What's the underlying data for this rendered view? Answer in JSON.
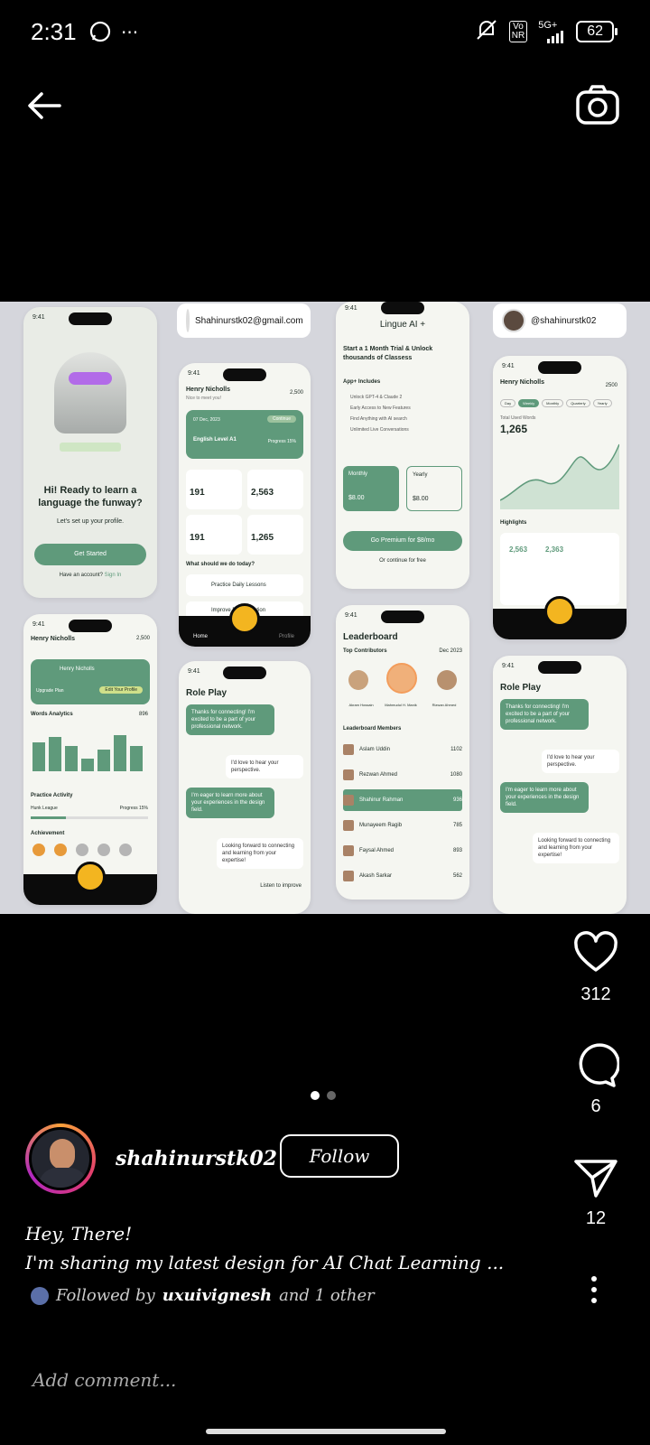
{
  "status": {
    "time": "2:31",
    "network": "5G+",
    "volte_top": "Vo",
    "volte_bottom": "NR",
    "battery": "62"
  },
  "post": {
    "email": "Shahinurstk02@gmail.com",
    "handle": "@shahinurstk02",
    "likes": "312",
    "comments": "6",
    "shares": "12",
    "username": "shahinurstk02",
    "follow_label": "Follow",
    "caption_line1": "Hey, There!",
    "caption_line2": "I'm sharing my latest design for AI Chat Learning ...",
    "followed_by_prefix": "Followed by",
    "followed_by_user": "uxuivignesh",
    "followed_by_suffix": "and 1 other",
    "comment_placeholder": "Add comment..."
  },
  "screens": {
    "time": "9:41",
    "welcome": {
      "headline": "Hi! Ready to learn a language the funway?",
      "sub": "Let's set up your profile.",
      "cta": "Get Started",
      "account_q": "Have an account?",
      "signin": "Sign In"
    },
    "home": {
      "name": "Henry Nicholls",
      "greet": "Nice to meet you!",
      "coins": "2,500",
      "date": "07 Dec, 2023",
      "course_label": "Current progress",
      "course": "English Level A1",
      "continue": "Continue",
      "progress": "Progress 15%",
      "s1": "191",
      "s2": "2,563",
      "s3": "191",
      "s4": "1,265",
      "today": "What should we do today?",
      "lesson": "Practice Daily Lessons",
      "improve": "Improve Pronunciation",
      "nav_home": "Home",
      "nav_profile": "Profile"
    },
    "premium": {
      "brand": "Lingue AI +",
      "trial": "Start a 1 Month Trial & Unlock thousands of Classess",
      "includes": "App+ Includes",
      "f1": "Unlock GPT-4 & Claude 2",
      "f2": "Early Access to New Features",
      "f3": "Find Anything with AI search",
      "f4": "Unlimited Live Conversations",
      "monthly": "Monthly",
      "yearly": "Yearly",
      "price_m": "$8.00",
      "price_y": "$8.00",
      "cta": "Go Premium for $8/mo",
      "free": "Or continue for free"
    },
    "stats": {
      "name": "Henry Nicholls",
      "coins": "2500",
      "tabs": [
        "Day",
        "Weekly",
        "Monthly",
        "Quarterly",
        "Yearly"
      ],
      "total_label": "Total Used Words",
      "total": "1,265",
      "highlights": "Highlights",
      "h1": "2,563",
      "h2": "2,363"
    },
    "profile": {
      "name": "Henry Nicholls",
      "coins": "2,500",
      "plan": "Upgrade Plan",
      "edit": "Edit Your Profile",
      "analytics": "Words Analytics",
      "analytics_val": "896",
      "practice": "Practice Activity",
      "league": "Hunk League",
      "league_progress": "Progress 15%",
      "achievement": "Achievement"
    },
    "roleplay": {
      "title": "Role Play",
      "m1": "Thanks for connecting! I'm excited to be a part of your professional network.",
      "m2": "I'd love to hear your perspective.",
      "m3": "I'm eager to learn more about your experiences in the design field.",
      "m4": "Looking forward to connecting and learning from your expertise!",
      "listen": "Listen to improve"
    },
    "leaderboard": {
      "title": "Leaderboard",
      "top": "Top Contributors",
      "month": "Dec 2023",
      "p1": "Akram Hossain",
      "p2": "Mahmudul H. Manik",
      "p3": "Rizwan Ahmed",
      "members": "Leaderboard Members",
      "rows": [
        {
          "name": "Aslam Uddin",
          "score": "1102"
        },
        {
          "name": "Rezwan Ahmed",
          "score": "1080"
        },
        {
          "name": "Shahinur Rahman",
          "score": "936"
        },
        {
          "name": "Munayeem Ragib",
          "score": "785"
        },
        {
          "name": "Faysal Ahmed",
          "score": "893"
        },
        {
          "name": "Akash Sarkar",
          "score": "562"
        }
      ]
    }
  }
}
